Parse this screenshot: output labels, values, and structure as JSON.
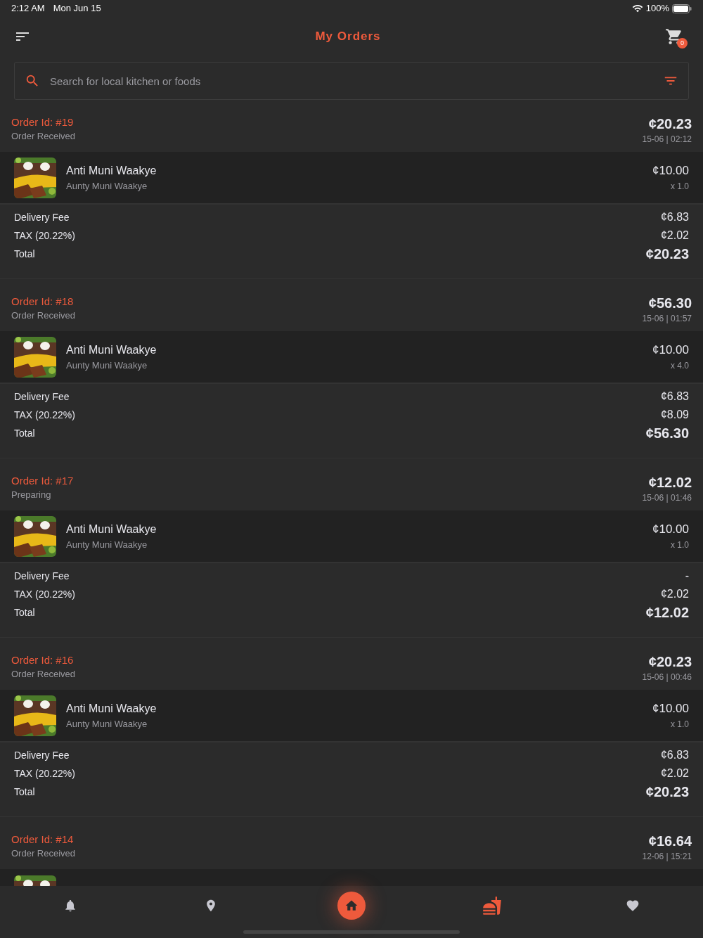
{
  "status_bar": {
    "time": "2:12 AM",
    "date": "Mon Jun 15",
    "battery": "100%"
  },
  "app_bar": {
    "title": "My Orders",
    "cart_count": "0"
  },
  "search": {
    "placeholder": "Search for local kitchen or foods"
  },
  "orders": [
    {
      "id": "Order Id: #19",
      "status": "Order Received",
      "total": "¢20.23",
      "datetime": "15-06 | 02:12",
      "items": [
        {
          "kind": "full",
          "name": "Anti Muni Waakye",
          "vendor": "Aunty Muni Waakye",
          "price": "¢10.00",
          "qty": "x 1.0"
        }
      ],
      "fees": [
        {
          "label": "Delivery Fee",
          "value": "¢6.83"
        },
        {
          "label": "TAX (20.22%)",
          "value": "¢2.02"
        },
        {
          "label": "Total",
          "value": "¢20.23"
        }
      ]
    },
    {
      "id": "Order Id: #18",
      "status": "Order Received",
      "total": "¢56.30",
      "datetime": "15-06 | 01:57",
      "items": [
        {
          "kind": "full",
          "name": "Anti Muni Waakye",
          "vendor": "Aunty Muni Waakye",
          "price": "¢10.00",
          "qty": "x 4.0"
        }
      ],
      "fees": [
        {
          "label": "Delivery Fee",
          "value": "¢6.83"
        },
        {
          "label": "TAX (20.22%)",
          "value": "¢8.09"
        },
        {
          "label": "Total",
          "value": "¢56.30"
        }
      ]
    },
    {
      "id": "Order Id: #17",
      "status": "Preparing",
      "total": "¢12.02",
      "datetime": "15-06 | 01:46",
      "items": [
        {
          "kind": "full",
          "name": "Anti Muni Waakye",
          "vendor": "Aunty Muni Waakye",
          "price": "¢10.00",
          "qty": "x 1.0"
        }
      ],
      "fees": [
        {
          "label": "Delivery Fee",
          "value": "-"
        },
        {
          "label": "TAX (20.22%)",
          "value": "¢2.02"
        },
        {
          "label": "Total",
          "value": "¢12.02"
        }
      ]
    },
    {
      "id": "Order Id: #16",
      "status": "Order Received",
      "total": "¢20.23",
      "datetime": "15-06 | 00:46",
      "items": [
        {
          "kind": "full",
          "name": "Anti Muni Waakye",
          "vendor": "Aunty Muni Waakye",
          "price": "¢10.00",
          "qty": "x 1.0"
        }
      ],
      "fees": [
        {
          "label": "Delivery Fee",
          "value": "¢6.83"
        },
        {
          "label": "TAX (20.22%)",
          "value": "¢2.02"
        },
        {
          "label": "Total",
          "value": "¢20.23"
        }
      ]
    },
    {
      "id": "Order Id: #14",
      "status": "Order Received",
      "total": "¢16.64",
      "datetime": "12-06 | 15:21"
    }
  ],
  "nav": [
    {
      "kind": "bell",
      "selected": false
    },
    {
      "kind": "pin",
      "selected": false
    },
    {
      "kind": "home",
      "selected": false
    },
    {
      "kind": "food",
      "selected": true
    },
    {
      "kind": "heart",
      "selected": false
    }
  ]
}
